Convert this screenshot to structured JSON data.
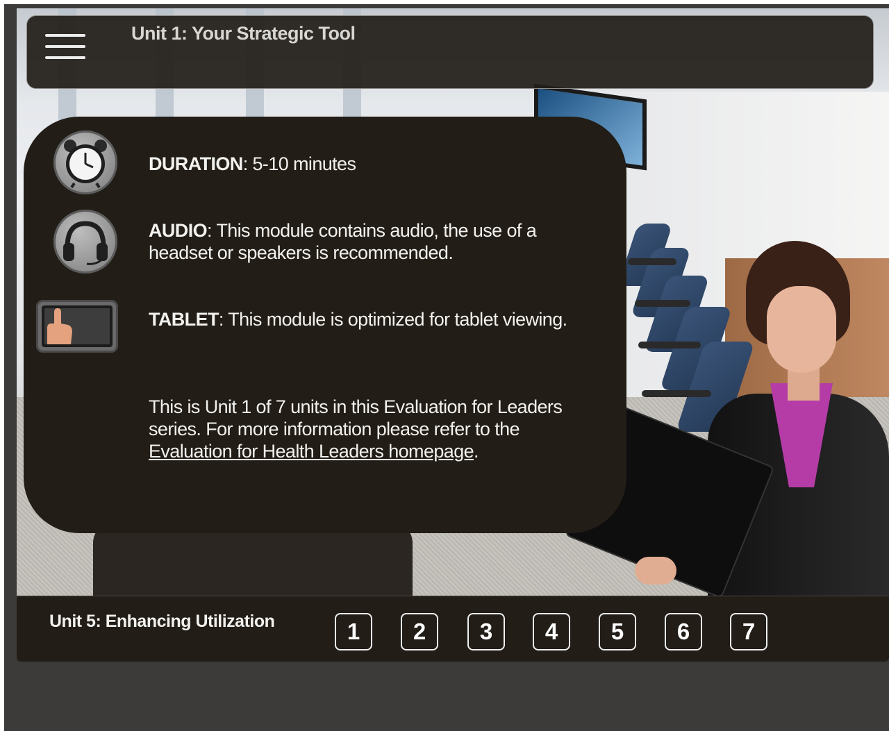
{
  "header": {
    "title": "Unit 1: Your Strategic Tool",
    "menu_icon": "hamburger-menu-icon"
  },
  "info": {
    "duration": {
      "icon": "alarm-clock-icon",
      "label": "DURATION",
      "text": ": 5-10 minutes"
    },
    "audio": {
      "icon": "headphones-icon",
      "label": "AUDIO",
      "text": ": This module contains audio, the use of a headset or speakers is recommended."
    },
    "tablet": {
      "icon": "tablet-touch-icon",
      "label": "TABLET",
      "text": ": This module is optimized for tablet viewing."
    },
    "series": {
      "text_before": "This is Unit 1 of 7 units in this Evaluation for Leaders series. For more information please refer to the ",
      "link_text": "Evaluation for Health Leaders homepage",
      "text_after": "."
    }
  },
  "footer": {
    "title": "Unit 5: Enhancing Utilization",
    "units": [
      "1",
      "2",
      "3",
      "4",
      "5",
      "6",
      "7"
    ]
  },
  "colors": {
    "panel": "#221d17",
    "frame": "#3c3b3a",
    "text": "#f2f1ee",
    "header_text": "#d8d6d2"
  }
}
